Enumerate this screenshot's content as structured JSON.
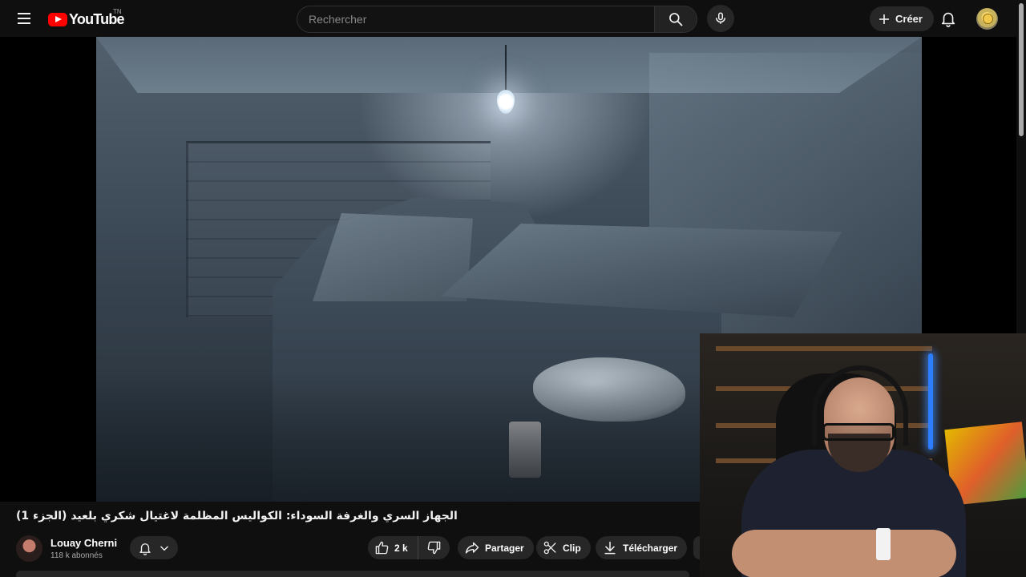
{
  "header": {
    "logo_text": "YouTube",
    "country_code": "TN",
    "search_placeholder": "Rechercher",
    "create_label": "Créer"
  },
  "video": {
    "title": "الجهاز السري والغرفة السوداء: الكواليس المظلمة لاغتيال شكري بلعيد (الجزء 1)"
  },
  "channel": {
    "name": "Louay Cherni",
    "subscribers": "118 k abonnés"
  },
  "actions": {
    "like_count": "2 k",
    "share_label": "Partager",
    "clip_label": "Clip",
    "download_label": "Télécharger"
  },
  "icons": {
    "menu": "menu-icon",
    "search": "search-icon",
    "mic": "mic-icon",
    "create": "plus-icon",
    "notifications": "bell-icon",
    "like": "thumbs-up-icon",
    "dislike": "thumbs-down-icon",
    "share": "share-icon",
    "clip": "scissors-icon",
    "download": "download-icon"
  },
  "colors": {
    "background": "#0f0f0f",
    "brand_red": "#ff0000",
    "button_bg": "#272727"
  }
}
